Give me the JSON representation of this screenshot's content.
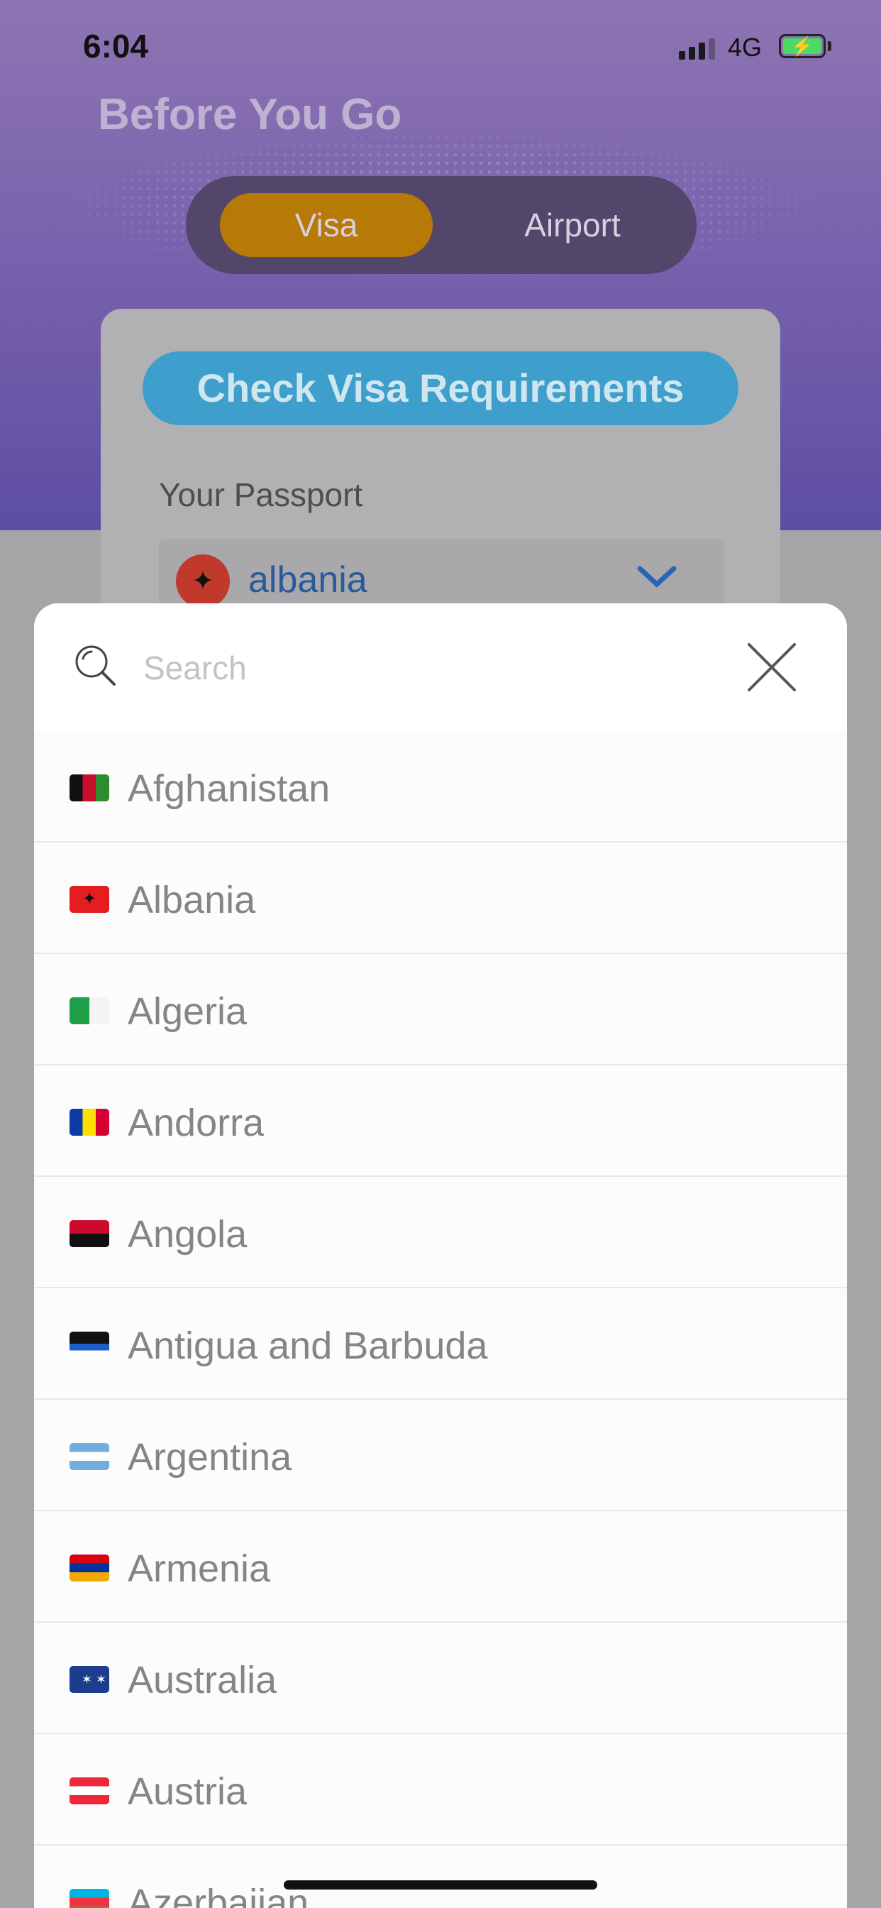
{
  "status_bar": {
    "time": "6:04",
    "network": "4G"
  },
  "header": {
    "title": "Before You Go"
  },
  "tabs": [
    {
      "label": "Visa",
      "selected": true
    },
    {
      "label": "Airport",
      "selected": false
    }
  ],
  "card": {
    "check_button": "Check Visa Requirements",
    "passport_label": "Your Passport",
    "passport_value": "albania"
  },
  "country_picker": {
    "search_placeholder": "Search",
    "search_value": "",
    "countries": [
      {
        "name": "Afghanistan",
        "flag": "afghanistan-flag"
      },
      {
        "name": "Albania",
        "flag": "albania-flag"
      },
      {
        "name": "Algeria",
        "flag": "algeria-flag"
      },
      {
        "name": "Andorra",
        "flag": "andorra-flag"
      },
      {
        "name": "Angola",
        "flag": "angola-flag"
      },
      {
        "name": "Antigua and Barbuda",
        "flag": "antigua-and-barbuda-flag"
      },
      {
        "name": "Argentina",
        "flag": "argentina-flag"
      },
      {
        "name": "Armenia",
        "flag": "armenia-flag"
      },
      {
        "name": "Australia",
        "flag": "australia-flag"
      },
      {
        "name": "Austria",
        "flag": "austria-flag"
      },
      {
        "name": "Azerbaijan",
        "flag": "azerbaijan-flag"
      }
    ]
  },
  "colors": {
    "header_purple": "#7a63ae",
    "visa_tab": "#b77a06",
    "check_button": "#3f9fcc",
    "country_text": "#858585"
  }
}
